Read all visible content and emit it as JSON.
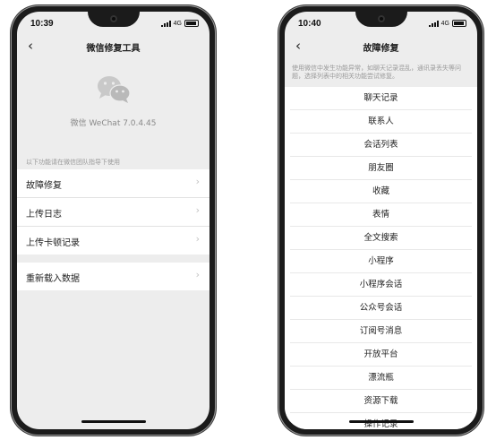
{
  "left": {
    "time": "10:39",
    "network": "4G",
    "back": "‹",
    "title": "微信修复工具",
    "version": "微信 WeChat 7.0.4.45",
    "hint": "以下功能请在微信团队指导下使用",
    "group1": [
      {
        "label": "故障修复"
      },
      {
        "label": "上传日志"
      },
      {
        "label": "上传卡顿记录"
      }
    ],
    "group2": [
      {
        "label": "重新载入数据"
      }
    ],
    "chevron": "›"
  },
  "right": {
    "time": "10:40",
    "network": "4G",
    "back": "‹",
    "title": "故障修复",
    "description": "使用微信中发生功能异常，如聊天记录混乱，通讯录丢失等问题，选择列表中的相关功能尝试修复。",
    "items": [
      "聊天记录",
      "联系人",
      "会话列表",
      "朋友圈",
      "收藏",
      "表情",
      "全文搜索",
      "小程序",
      "小程序会话",
      "公众号会话",
      "订阅号消息",
      "开放平台",
      "漂流瓶",
      "资源下载",
      "操作记录"
    ]
  }
}
